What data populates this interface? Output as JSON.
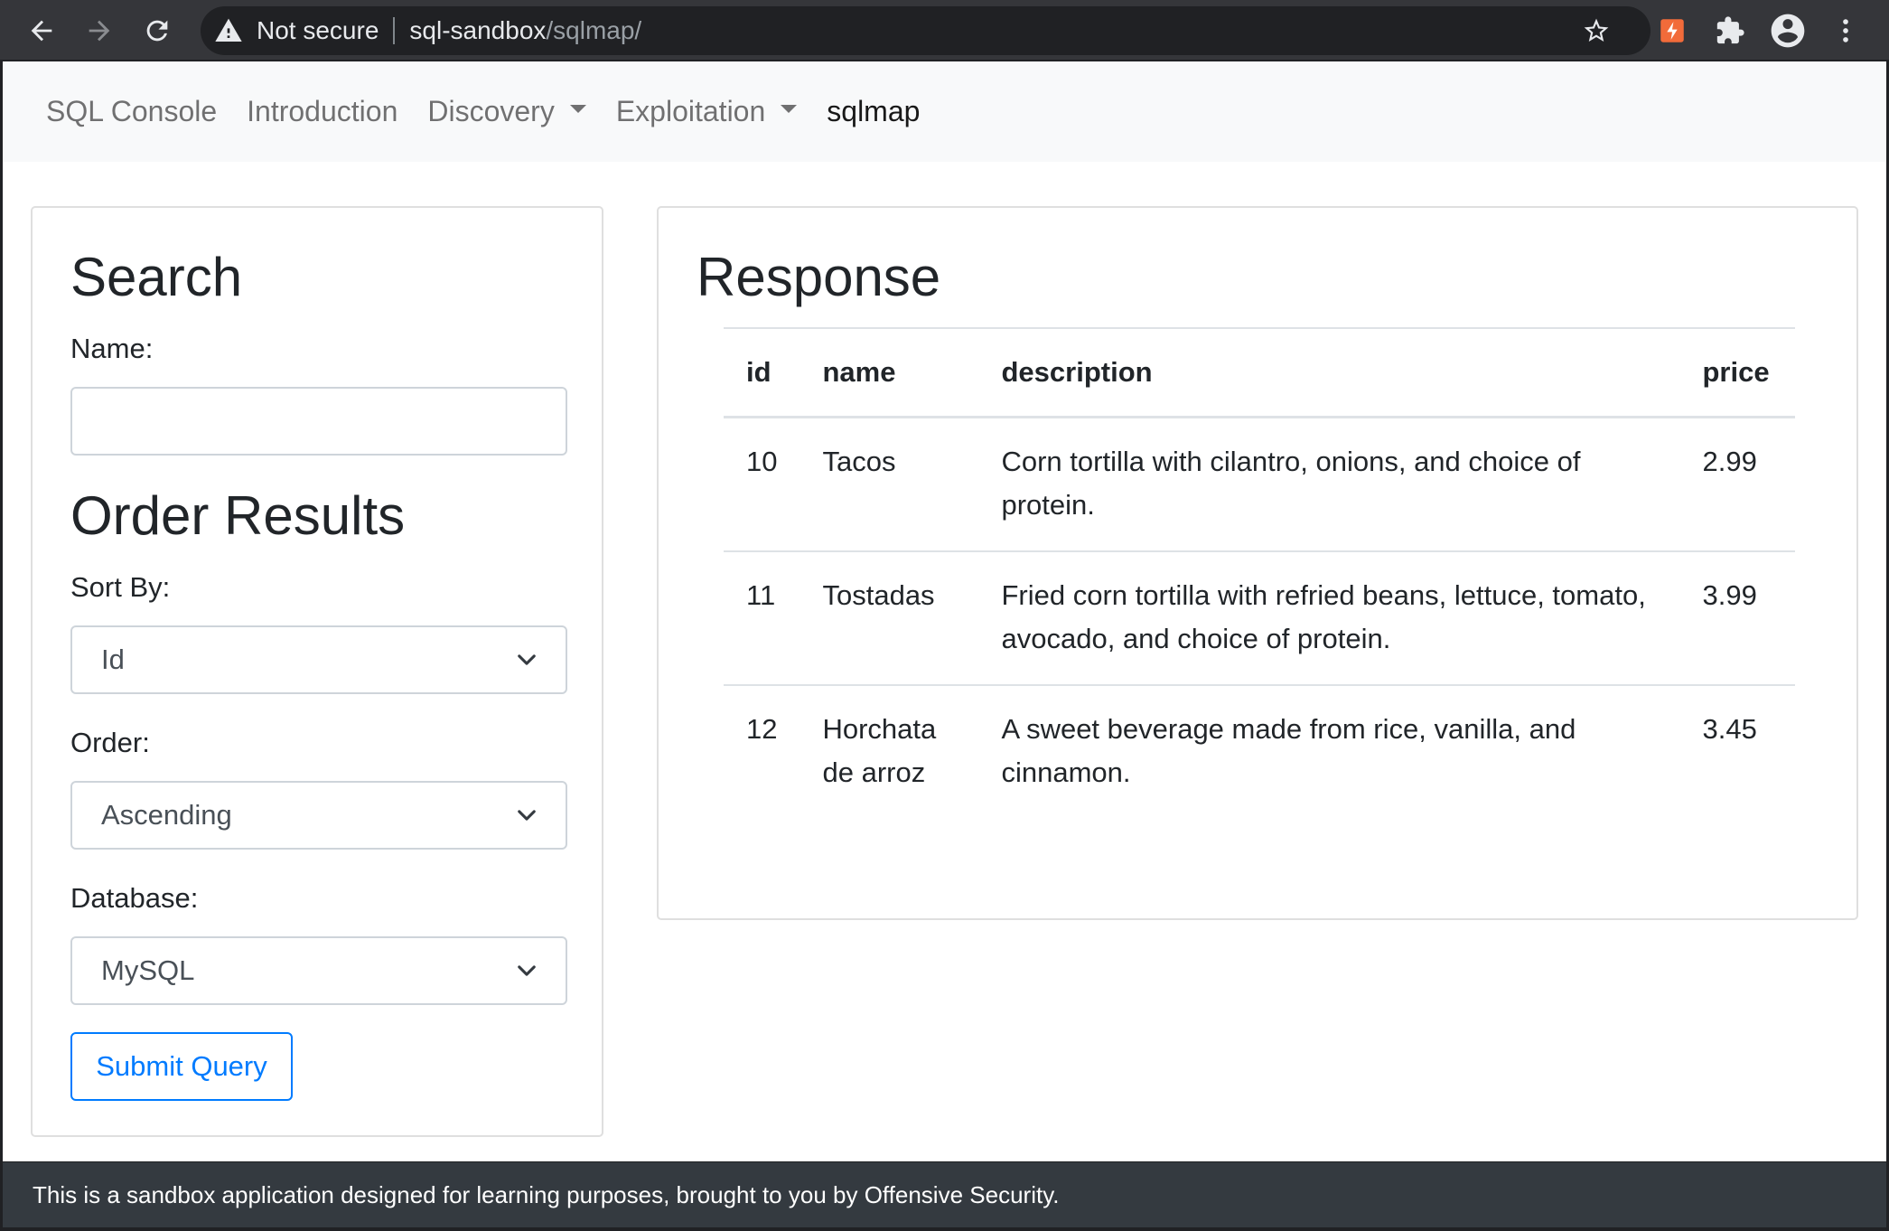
{
  "browser": {
    "security_label": "Not secure",
    "url_host": "sql-sandbox",
    "url_path": "/sqlmap/",
    "icons": [
      "back-icon",
      "forward-icon",
      "reload-icon",
      "warning-icon",
      "star-icon",
      "extension-icon",
      "puzzle-icon",
      "profile-icon",
      "menu-icon"
    ]
  },
  "navbar": {
    "items": [
      {
        "label": "SQL Console",
        "dropdown": false,
        "active": false
      },
      {
        "label": "Introduction",
        "dropdown": false,
        "active": false
      },
      {
        "label": "Discovery",
        "dropdown": true,
        "active": false
      },
      {
        "label": "Exploitation",
        "dropdown": true,
        "active": false
      },
      {
        "label": "sqlmap",
        "dropdown": false,
        "active": true
      }
    ]
  },
  "search_panel": {
    "title": "Search",
    "name_label": "Name:",
    "name_value": "",
    "order_title": "Order Results",
    "sort_label": "Sort By:",
    "sort_value": "Id",
    "order_label": "Order:",
    "order_value": "Ascending",
    "database_label": "Database:",
    "database_value": "MySQL",
    "submit_label": "Submit Query"
  },
  "response_panel": {
    "title": "Response",
    "columns": [
      "id",
      "name",
      "description",
      "price"
    ],
    "rows": [
      {
        "id": "10",
        "name": "Tacos",
        "description": "Corn tortilla with cilantro, onions, and choice of protein.",
        "price": "2.99"
      },
      {
        "id": "11",
        "name": "Tostadas",
        "description": "Fried corn tortilla with refried beans, lettuce, tomato, avocado, and choice of protein.",
        "price": "3.99"
      },
      {
        "id": "12",
        "name": "Horchata de arroz",
        "description": "A sweet beverage made from rice, vanilla, and cinnamon.",
        "price": "3.45"
      }
    ]
  },
  "footer": {
    "text": "This is a sandbox application designed for learning purposes, brought to you by Offensive Security."
  },
  "colors": {
    "chrome_bg": "#35363a",
    "navbar_bg": "#f8f9fa",
    "accent": "#007bff",
    "footer_bg": "#343a40",
    "extension_badge": "#f26b3a"
  }
}
